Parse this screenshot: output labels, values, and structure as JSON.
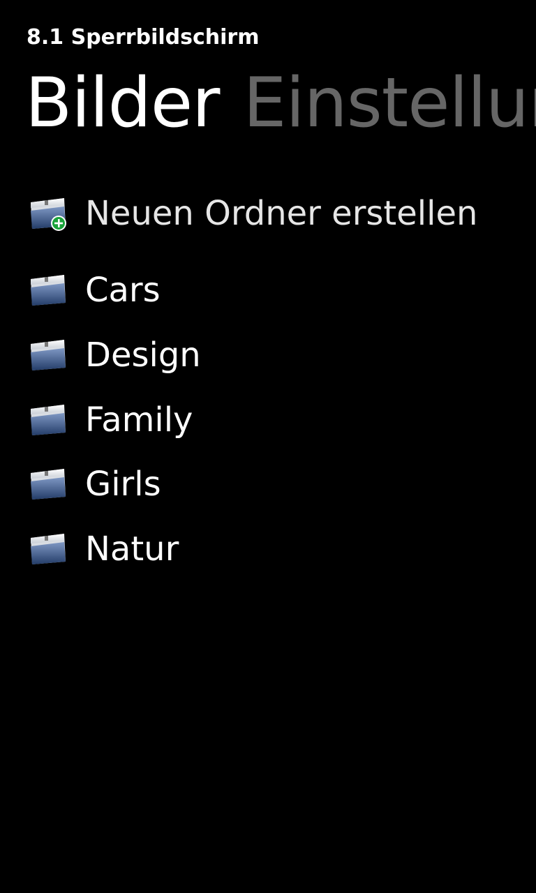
{
  "app": {
    "title": "8.1 Sperrbildschirm"
  },
  "pivot": {
    "items": [
      {
        "label": "Bilder",
        "active": true
      },
      {
        "label": "Einstellungen",
        "active": false
      }
    ]
  },
  "actions": {
    "new_folder": {
      "label": "Neuen Ordner erstellen",
      "icon": "folder-add-icon"
    }
  },
  "folders": [
    {
      "label": "Cars",
      "icon": "folder-icon"
    },
    {
      "label": "Design",
      "icon": "folder-icon"
    },
    {
      "label": "Family",
      "icon": "folder-icon"
    },
    {
      "label": "Girls",
      "icon": "folder-icon"
    },
    {
      "label": "Natur",
      "icon": "folder-icon"
    }
  ],
  "colors": {
    "background": "#000000",
    "text": "#ffffff",
    "inactive_pivot": "#666666",
    "folder_blue": "#2f4a78",
    "add_badge": "#1aa33a"
  }
}
